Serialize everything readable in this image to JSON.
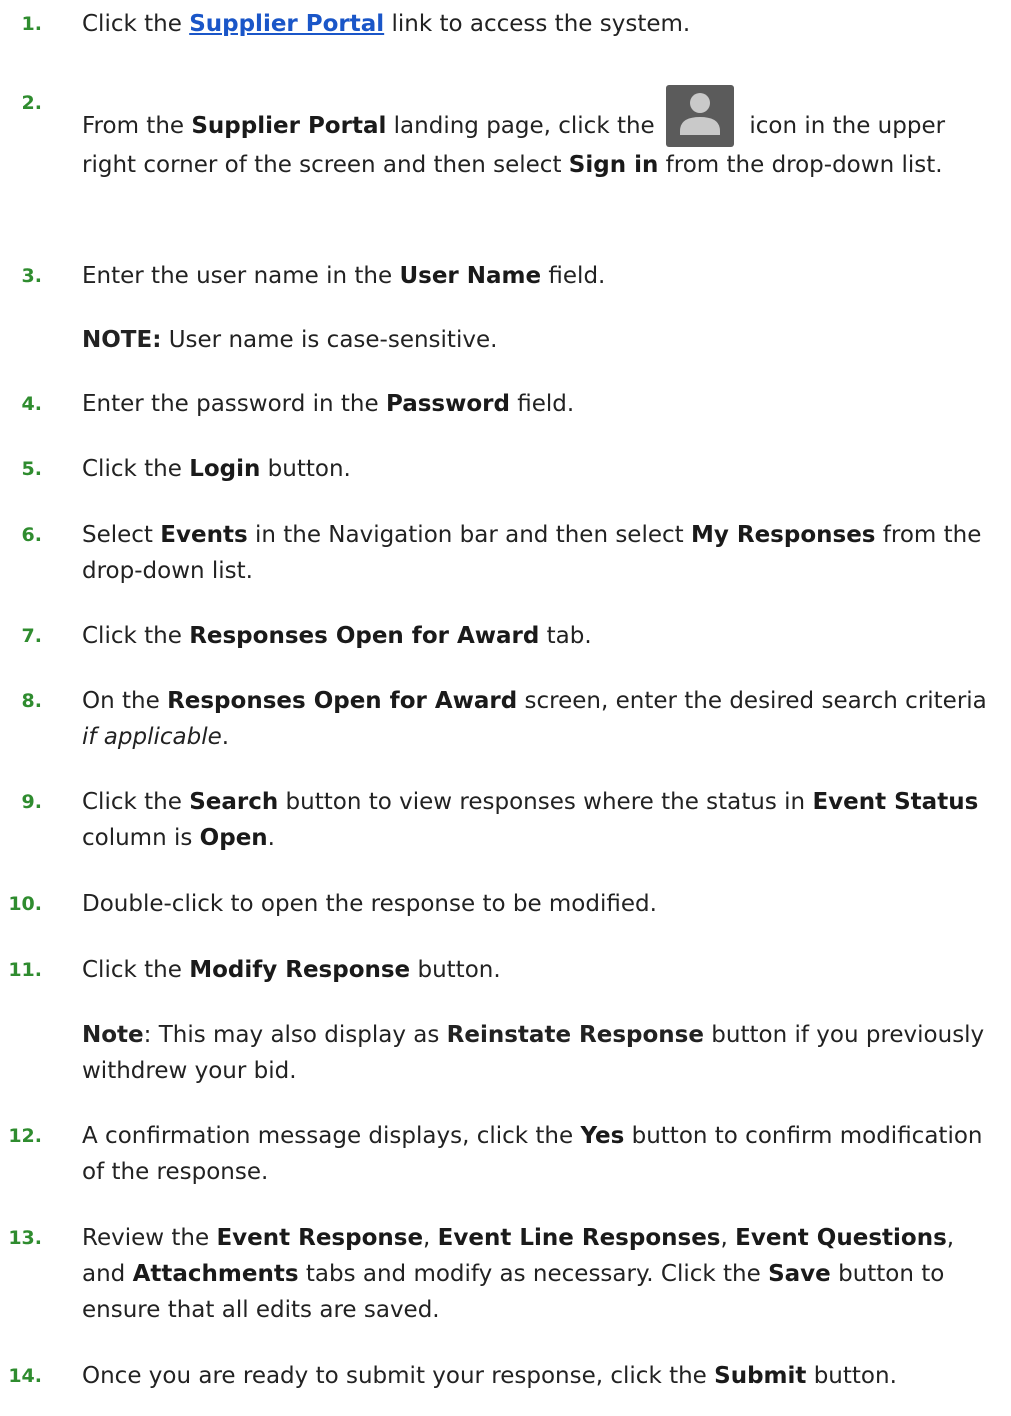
{
  "steps": [
    {
      "num": "1.",
      "pre": "Click the ",
      "link": "Supplier Portal",
      "post": " link to access the system."
    },
    {
      "num": "2.",
      "a": "From the ",
      "b1": "Supplier Portal",
      "c": " landing page, click the ",
      "d": " icon in the upper right corner of the screen and then select ",
      "b2": "Sign in",
      "e": " from the drop-down list."
    },
    {
      "num": "3.",
      "a": "Enter the user name in the ",
      "b": "User Name",
      "c": " field."
    },
    {
      "note3_label": "NOTE:",
      "note3_text": " User name is case-sensitive."
    },
    {
      "num": "4.",
      "a": "Enter the password in the ",
      "b": "Password",
      "c": " field."
    },
    {
      "num": "5.",
      "a": "Click the ",
      "b": "Login",
      "c": " button."
    },
    {
      "num": "6.",
      "a": "Select ",
      "b1": "Events",
      "c": " in the Navigation bar and then select ",
      "b2": "My Responses",
      "d": " from the drop-down list."
    },
    {
      "num": "7.",
      "a": "Click the ",
      "b": "Responses Open for Award",
      "c": " tab."
    },
    {
      "num": "8.",
      "a": "On the ",
      "b": "Responses Open for Award",
      "c": " screen, enter the desired search criteria ",
      "i": "if applicable",
      "d": "."
    },
    {
      "num": "9.",
      "a": "Click the ",
      "b1": "Search",
      "c": " button to view responses where the status in ",
      "b2": "Event Status",
      "d": " column is ",
      "b3": "Open",
      "e": "."
    },
    {
      "num": "10.",
      "a": "Double-click to open the response to be modified."
    },
    {
      "num": "11.",
      "a": "Click the ",
      "b": "Modify Response",
      "c": " button."
    },
    {
      "note11_label": "Note",
      "note11_text": ": This may also display as ",
      "note11_b": "Reinstate Response",
      "note11_end": " button if you previously withdrew your bid."
    },
    {
      "num": "12.",
      "a": "A confirmation message displays, click the ",
      "b": "Yes",
      "c": " button to confirm modification of the response."
    },
    {
      "num": "13.",
      "a": "Review the ",
      "b1": "Event Response",
      "s1": ", ",
      "b2": "Event Line Responses",
      "s2": ", ",
      "b3": "Event Questions",
      "s3": ", and ",
      "b4": "Attachments",
      "c": " tabs and modify as necessary. Click the ",
      "b5": "Save",
      "d": " button to ensure that all edits are saved."
    },
    {
      "num": "14.",
      "a": "Once you are ready to submit your response, click the ",
      "b": "Submit",
      "c": " button."
    }
  ],
  "icons": {
    "user": "user-avatar-icon"
  },
  "colors": {
    "step_number": "#2f8c2f",
    "link": "#1a56c8",
    "icon_bg": "#5b5b5b"
  }
}
